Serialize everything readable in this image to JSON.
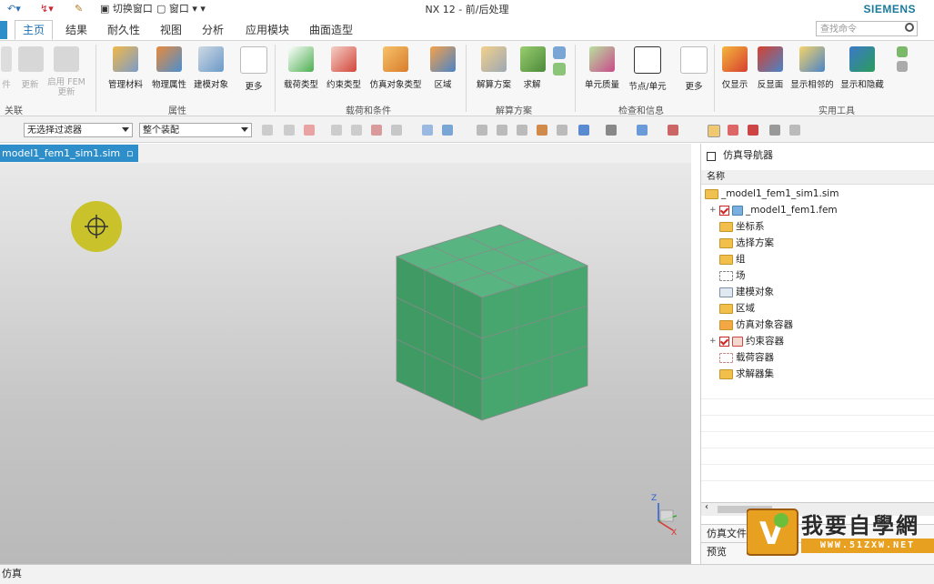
{
  "app": {
    "title": "NX 12 - 前/后处理",
    "brand": "SIEMENS"
  },
  "quick_access": {
    "switch_window": "切换窗口",
    "window": "窗口"
  },
  "menu": {
    "tabs": [
      "主页",
      "结果",
      "耐久性",
      "视图",
      "分析",
      "应用模块",
      "曲面造型"
    ],
    "search_placeholder": "查找命令"
  },
  "ribbon": {
    "groups": {
      "link": {
        "label": "关联",
        "buttons": [
          "件",
          "更新",
          "启用 FEM 更新"
        ]
      },
      "properties": {
        "label": "属性",
        "buttons": [
          "管理材料",
          "物理属性",
          "建模对象",
          "更多"
        ]
      },
      "loads": {
        "label": "载荷和条件",
        "buttons": [
          "载荷类型",
          "约束类型",
          "仿真对象类型",
          "区域"
        ]
      },
      "solution": {
        "label": "解算方案",
        "buttons": [
          "解算方案",
          "求解"
        ]
      },
      "check": {
        "label": "检查和信息",
        "buttons": [
          "单元质量",
          "节点/单元",
          "更多"
        ]
      },
      "utility": {
        "label": "实用工具",
        "buttons": [
          "仅显示",
          "反显面",
          "显示相邻的",
          "显示和隐藏"
        ]
      }
    }
  },
  "filterbar": {
    "filter": "无选择过滤器",
    "scope": "整个装配"
  },
  "document": {
    "tab": "model1_fem1_sim1.sim"
  },
  "navigator": {
    "title": "仿真导航器",
    "column": "名称",
    "root": "_model1_fem1_sim1.sim",
    "items": [
      {
        "label": "_model1_fem1.fem",
        "type": "fem"
      },
      {
        "label": "坐标系",
        "type": "folder"
      },
      {
        "label": "选择方案",
        "type": "folder"
      },
      {
        "label": "组",
        "type": "folder"
      },
      {
        "label": "场",
        "type": "field"
      },
      {
        "label": "建模对象",
        "type": "object"
      },
      {
        "label": "区域",
        "type": "folder"
      },
      {
        "label": "仿真对象容器",
        "type": "sim"
      },
      {
        "label": "约束容器",
        "type": "constraint"
      },
      {
        "label": "载荷容器",
        "type": "load"
      },
      {
        "label": "求解器集",
        "type": "folder"
      }
    ],
    "bottom_panels": [
      "仿真文件",
      "预览"
    ]
  },
  "viewport": {
    "triad_z": "Z",
    "triad_x": "X"
  },
  "statusbar": {
    "text": "仿真"
  },
  "watermark": {
    "title": "我要自學網",
    "url": "WWW.51ZXW.NET"
  },
  "colors": {
    "accent": "#2e8ec9",
    "cube": "#4aa874",
    "brand": "#1a7a9c"
  }
}
